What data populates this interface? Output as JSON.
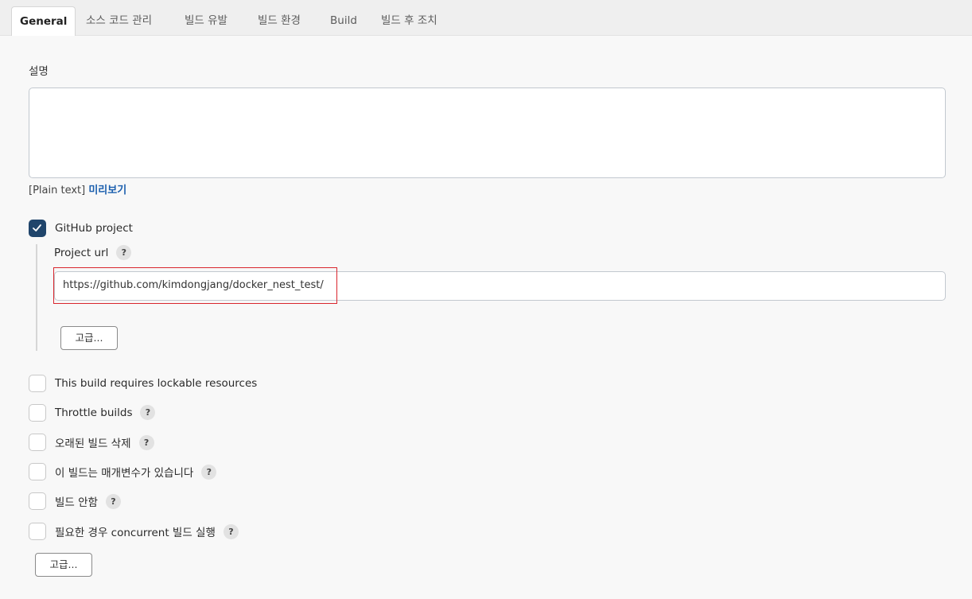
{
  "tabs": [
    {
      "label": "General",
      "active": true
    },
    {
      "label": "소스 코드 관리"
    },
    {
      "label": "빌드 유발"
    },
    {
      "label": "빌드 환경"
    },
    {
      "label": "Build"
    },
    {
      "label": "빌드 후 조치"
    }
  ],
  "description": {
    "label": "설명",
    "value": "",
    "format_text": "[Plain text]",
    "preview_link": "미리보기"
  },
  "github_project": {
    "label": "GitHub project",
    "checked": true,
    "project_url_label": "Project url",
    "project_url_value": "https://github.com/kimdongjang/docker_nest_test/",
    "advanced_button": "고급..."
  },
  "options": [
    {
      "label": "This build requires lockable resources",
      "checked": false,
      "help": false
    },
    {
      "label": "Throttle builds",
      "checked": false,
      "help": true
    },
    {
      "label": "오래된 빌드 삭제",
      "checked": false,
      "help": true
    },
    {
      "label": "이 빌드는 매개변수가 있습니다",
      "checked": false,
      "help": true
    },
    {
      "label": "빌드 안함",
      "checked": false,
      "help": true
    },
    {
      "label": "필요한 경우 concurrent 빌드 실행",
      "checked": false,
      "help": true
    }
  ],
  "help_glyph": "?",
  "advanced_button": "고급...",
  "colors": {
    "checkbox_checked": "#20456b",
    "link": "#1b5fae",
    "highlight_box": "#d9262e"
  }
}
